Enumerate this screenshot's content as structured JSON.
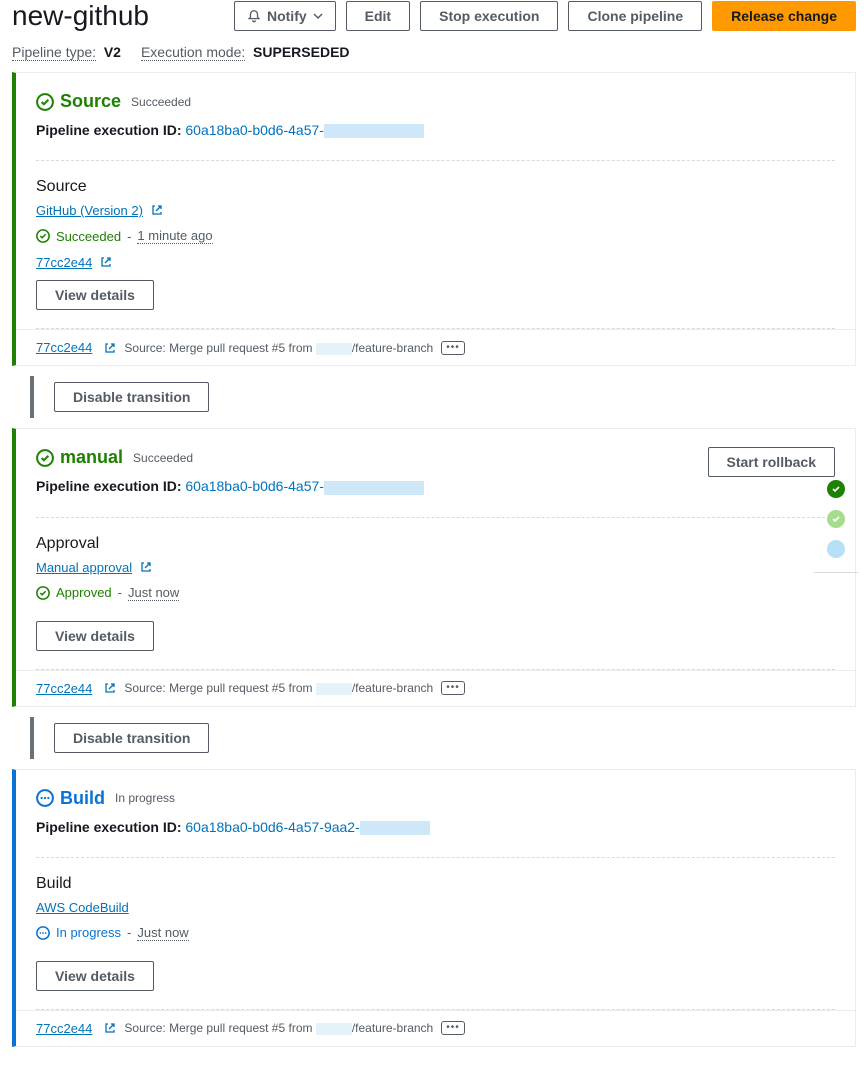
{
  "header": {
    "title": "new-github",
    "notify": "Notify",
    "edit": "Edit",
    "stop": "Stop execution",
    "clone": "Clone pipeline",
    "release": "Release change"
  },
  "meta": {
    "type_label": "Pipeline type:",
    "type_val": "V2",
    "mode_label": "Execution mode:",
    "mode_val": "SUPERSEDED"
  },
  "execId": {
    "label": "Pipeline execution ID:"
  },
  "transition": {
    "disable": "Disable transition"
  },
  "details_btn": "View details",
  "stages": [
    {
      "name": "Source",
      "status": "Succeeded",
      "state": "succeeded",
      "exec": "60a18ba0-b0d6-4a57-",
      "action": {
        "name": "Source",
        "provider": "GitHub (Version 2)",
        "status_text": "Succeeded",
        "time": "1 minute ago",
        "commit": "77cc2e44"
      },
      "footer": {
        "commit": "77cc2e44",
        "prefix": "Source: Merge pull request #5 from",
        "suffix": "/feature-branch"
      }
    },
    {
      "name": "manual",
      "status": "Succeeded",
      "state": "succeeded",
      "rollback": "Start rollback",
      "exec": "60a18ba0-b0d6-4a57-",
      "action": {
        "name": "Approval",
        "provider": "Manual approval",
        "status_text": "Approved",
        "time": "Just now"
      },
      "footer": {
        "commit": "77cc2e44",
        "prefix": "Source: Merge pull request #5 from",
        "suffix": "/feature-branch"
      }
    },
    {
      "name": "Build",
      "status": "In progress",
      "state": "inprogress",
      "exec": "60a18ba0-b0d6-4a57-9aa2-",
      "action": {
        "name": "Build",
        "provider": "AWS CodeBuild",
        "status_text": "In progress",
        "time": "Just now"
      },
      "footer": {
        "commit": "77cc2e44",
        "prefix": "Source: Merge pull request #5 from",
        "suffix": "/feature-branch"
      }
    }
  ]
}
